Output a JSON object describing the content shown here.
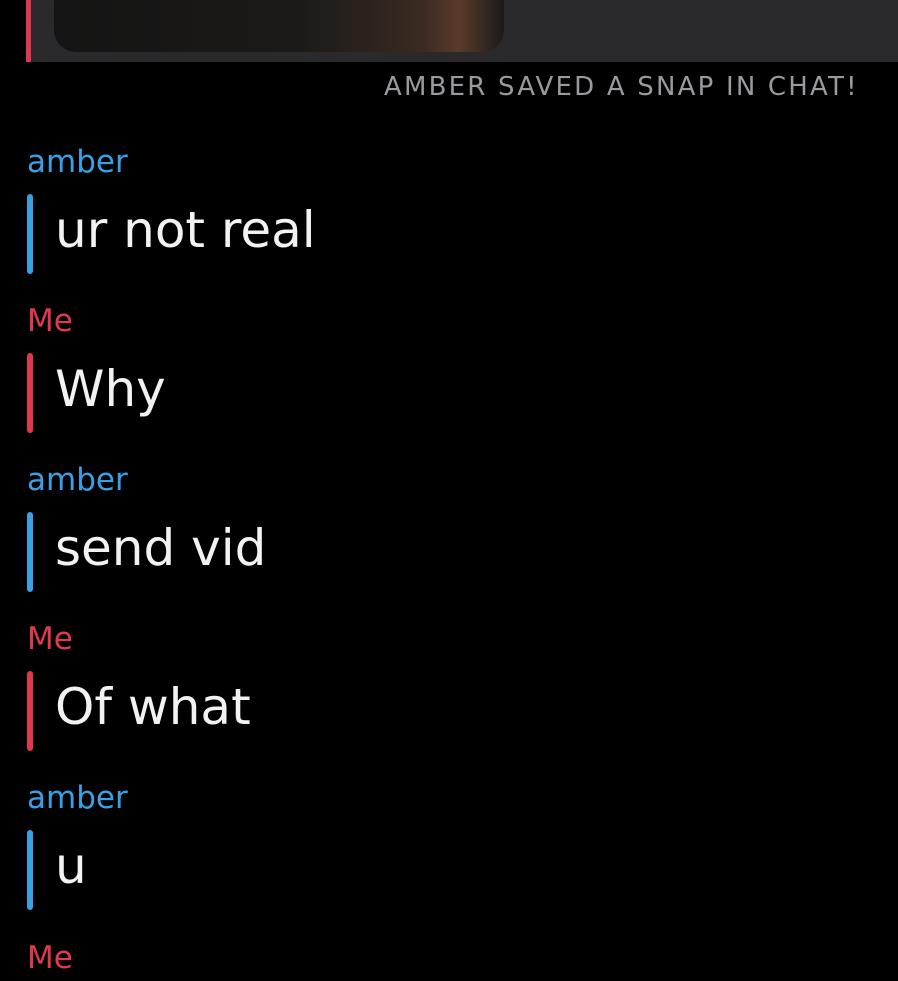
{
  "colors": {
    "background": "#000000",
    "friend": "#3aa0e6",
    "self": "#e0384f",
    "message_text": "#f2f2f2",
    "system_text": "#9a9a9e"
  },
  "system_note": "AMBER SAVED A SNAP IN CHAT!",
  "messages": [
    {
      "sender": "amber",
      "sender_type": "friend",
      "text": "ur not real"
    },
    {
      "sender": "Me",
      "sender_type": "self",
      "text": "Why"
    },
    {
      "sender": "amber",
      "sender_type": "friend",
      "text": "send vid"
    },
    {
      "sender": "Me",
      "sender_type": "self",
      "text": "Of what"
    },
    {
      "sender": "amber",
      "sender_type": "friend",
      "text": "u"
    },
    {
      "sender": "Me",
      "sender_type": "self"
    }
  ]
}
